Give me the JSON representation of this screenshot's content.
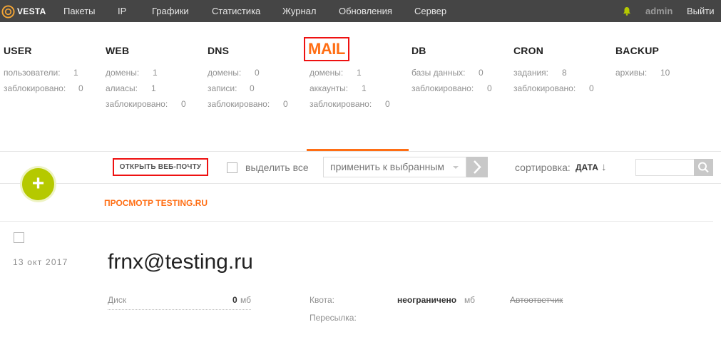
{
  "logo": {
    "text": "VESTA"
  },
  "nav": {
    "items": [
      "Пакеты",
      "IP",
      "Графики",
      "Статистика",
      "Журнал",
      "Обновления",
      "Сервер"
    ],
    "user": "admin",
    "logout": "Выйти"
  },
  "stats": [
    {
      "title": "USER",
      "rows": [
        {
          "label": "пользователи:",
          "value": "1"
        },
        {
          "label": "заблокировано:",
          "value": "0"
        }
      ]
    },
    {
      "title": "WEB",
      "rows": [
        {
          "label": "домены:",
          "value": "1"
        },
        {
          "label": "алиасы:",
          "value": "1"
        },
        {
          "label": "заблокировано:",
          "value": "0"
        }
      ]
    },
    {
      "title": "DNS",
      "rows": [
        {
          "label": "домены:",
          "value": "0"
        },
        {
          "label": "записи:",
          "value": "0"
        },
        {
          "label": "заблокировано:",
          "value": "0"
        }
      ]
    },
    {
      "title": "MAIL",
      "active": true,
      "rows": [
        {
          "label": "домены:",
          "value": "1"
        },
        {
          "label": "аккаунты:",
          "value": "1"
        },
        {
          "label": "заблокировано:",
          "value": "0"
        }
      ]
    },
    {
      "title": "DB",
      "rows": [
        {
          "label": "базы данных:",
          "value": "0"
        },
        {
          "label": "заблокировано:",
          "value": "0"
        }
      ]
    },
    {
      "title": "CRON",
      "rows": [
        {
          "label": "задания:",
          "value": "8"
        },
        {
          "label": "заблокировано:",
          "value": "0"
        }
      ]
    },
    {
      "title": "BACKUP",
      "rows": [
        {
          "label": "архивы:",
          "value": "10"
        }
      ]
    }
  ],
  "toolbar": {
    "add": "+",
    "open_webmail": "ОТКРЫТЬ ВЕБ-ПОЧТУ",
    "select_all": "выделить все",
    "bulk_action": "применить к выбранным",
    "sort_label": "сортировка:",
    "sort_value": "ДАТА",
    "sort_arrow": "↓",
    "search_placeholder": ""
  },
  "view_link": "ПРОСМОТР TESTING.RU",
  "item": {
    "date": "13 окт 2017",
    "title": "frnx@testing.ru",
    "disk_label": "Диск",
    "disk_value": "0",
    "disk_unit": "мб",
    "quota_label": "Квота:",
    "quota_value": "неограничено",
    "quota_unit": "мб",
    "autoreply": "Автоответчик",
    "forward_label": "Пересылка:"
  },
  "colors": {
    "accent": "#ff6e14",
    "add_button": "#b5c900",
    "topbar": "#454545",
    "highlight_box": "#ee1111"
  }
}
